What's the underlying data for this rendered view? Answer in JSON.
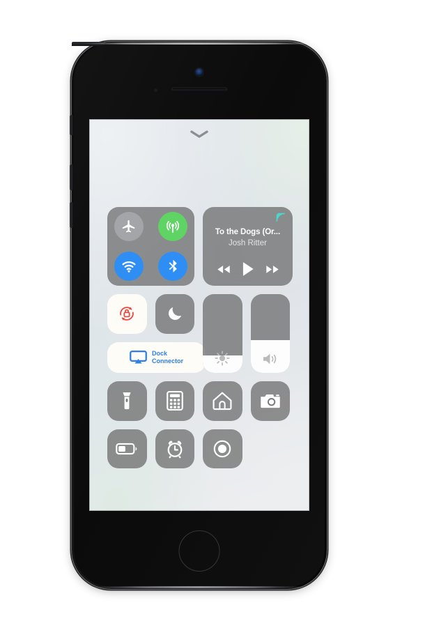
{
  "device": {
    "name": "iPhone",
    "camera": "front-camera",
    "speaker": "earpiece-speaker",
    "proximity_sensor": "proximity-sensor",
    "home_button": "home-button",
    "buttons": [
      "mute-switch",
      "volume-up",
      "volume-down",
      "power-button"
    ]
  },
  "screen": {
    "name": "Control Center",
    "grabber": "chevron-down-handle"
  },
  "connectivity": {
    "airplane_mode": {
      "label": "Airplane Mode",
      "state": "off",
      "color": "#a3a5a9"
    },
    "cellular_data": {
      "label": "Cellular Data",
      "state": "on",
      "color": "#5fd364"
    },
    "wifi": {
      "label": "Wi-Fi",
      "state": "on",
      "color": "#2f8ef4"
    },
    "bluetooth": {
      "label": "Bluetooth",
      "state": "on",
      "color": "#2f8ef4"
    }
  },
  "now_playing": {
    "title": "To the Dogs (Or...",
    "artist": "Josh Ritter",
    "airplay_icon": "airplay-waves",
    "airplay_color": "#49d8d2",
    "controls": {
      "previous": "rewind",
      "play": "play",
      "next": "fast-forward"
    },
    "playback_state": "paused"
  },
  "toggles": {
    "rotation_lock": {
      "label": "Portrait Orientation Lock",
      "state": "on",
      "icon_color": "#f0453a"
    },
    "do_not_disturb": {
      "label": "Do Not Disturb",
      "state": "off"
    },
    "screen_mirroring": {
      "label": "Dock Connector",
      "line1": "Dock",
      "line2": "Connector",
      "state": "on",
      "color": "#2f7fe8"
    }
  },
  "sliders": {
    "brightness": {
      "label": "Brightness",
      "value_percent": 22
    },
    "volume": {
      "label": "Volume",
      "value_percent": 42
    }
  },
  "utilities": [
    {
      "name": "flashlight",
      "label": "Flashlight"
    },
    {
      "name": "calculator",
      "label": "Calculator"
    },
    {
      "name": "home",
      "label": "Home"
    },
    {
      "name": "camera",
      "label": "Camera"
    },
    {
      "name": "low-power-mode",
      "label": "Low Power Mode"
    },
    {
      "name": "alarm",
      "label": "Alarm"
    },
    {
      "name": "screen-recording",
      "label": "Screen Recording"
    }
  ]
}
